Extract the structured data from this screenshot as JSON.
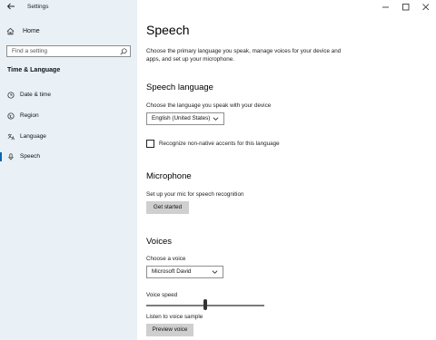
{
  "window": {
    "title": "Settings"
  },
  "sidebar": {
    "home_label": "Home",
    "search_placeholder": "Find a setting",
    "section_title": "Time & Language",
    "items": [
      {
        "label": "Date & time",
        "icon": "clock-icon"
      },
      {
        "label": "Region",
        "icon": "globe-icon"
      },
      {
        "label": "Language",
        "icon": "language-icon"
      },
      {
        "label": "Speech",
        "icon": "microphone-icon",
        "selected": true
      }
    ]
  },
  "main": {
    "title": "Speech",
    "description": "Choose the primary language you speak, manage voices for your device and apps, and set up your microphone.",
    "speech_language": {
      "heading": "Speech language",
      "label": "Choose the language you speak with your device",
      "selected": "English (United States)",
      "checkbox_label": "Recognize non-native accents for this language",
      "checkbox_checked": false
    },
    "microphone": {
      "heading": "Microphone",
      "label": "Set up your mic for speech recognition",
      "button": "Get started"
    },
    "voices": {
      "heading": "Voices",
      "label": "Choose a voice",
      "selected": "Microsoft David",
      "speed_label": "Voice speed",
      "speed_fraction": 0.5,
      "sample_label": "Listen to voice sample",
      "preview_button": "Preview voice"
    }
  },
  "colors": {
    "sidebar_bg": "#e9f1f7",
    "accent": "#0067b8",
    "button_bg": "#cfcfcf"
  }
}
